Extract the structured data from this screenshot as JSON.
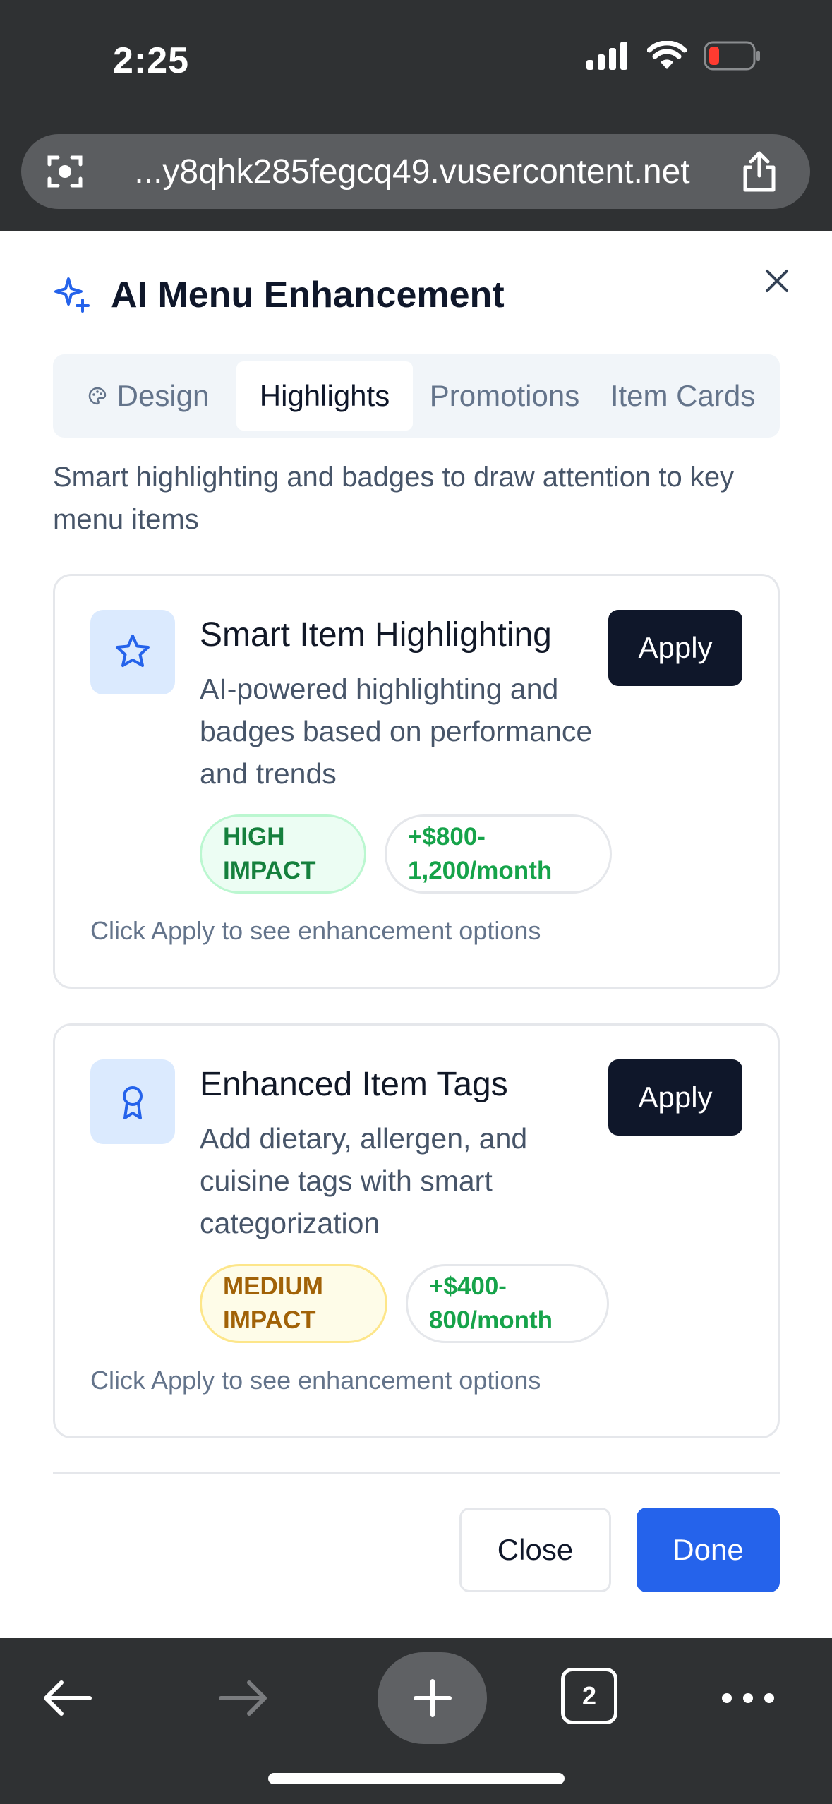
{
  "status_bar": {
    "time": "2:25"
  },
  "url_bar": {
    "url": "...y8qhk285fegcq49.vusercontent.net"
  },
  "modal": {
    "title": "AI Menu Enhancement",
    "tabs": [
      {
        "label": "Design",
        "icon": "palette-icon"
      },
      {
        "label": "Highlights"
      },
      {
        "label": "Promotions"
      },
      {
        "label": "Item Cards"
      }
    ],
    "active_tab": "Highlights",
    "subtitle": "Smart highlighting and badges to draw attention to key menu items",
    "cards": [
      {
        "icon": "star-icon",
        "title": "Smart Item Highlighting",
        "description": "AI-powered highlighting and badges based on performance and trends",
        "apply_label": "Apply",
        "impact": "HIGH IMPACT",
        "value": "+$800-1,200/month",
        "hint": "Click Apply to see enhancement options"
      },
      {
        "icon": "award-icon",
        "title": "Enhanced Item Tags",
        "description": "Add dietary, allergen, and cuisine tags with smart categorization",
        "apply_label": "Apply",
        "impact": "MEDIUM IMPACT",
        "value": "+$400-800/month",
        "hint": "Click Apply to see enhancement options"
      }
    ],
    "close_label": "Close",
    "done_label": "Done"
  },
  "toolbar": {
    "tab_count": "2"
  },
  "colors": {
    "accent": "#2563eb",
    "primary_dark": "#0f172a",
    "success": "#16a34a",
    "warning": "#a16207"
  }
}
